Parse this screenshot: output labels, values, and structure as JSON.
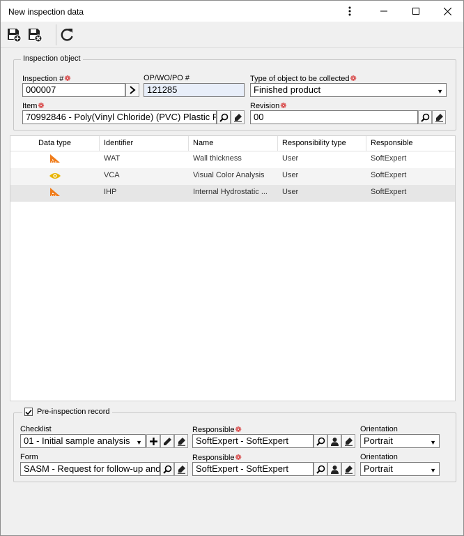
{
  "window": {
    "title": "New inspection data"
  },
  "toolbar": {
    "buttons": [
      {
        "icon": "save-new-icon"
      },
      {
        "icon": "save-close-icon"
      },
      {
        "icon": "refresh-icon"
      }
    ]
  },
  "inspection_object": {
    "legend": "Inspection object",
    "inspection_no": {
      "label": "Inspection #",
      "value": "000007"
    },
    "op_wo_po": {
      "label": "OP/WO/PO #",
      "value": "121285"
    },
    "object_type": {
      "label": "Type of object to be collected",
      "value": "Finished product"
    },
    "item": {
      "label": "Item",
      "value": "70992846 - Poly(Vinyl Chloride) (PVC) Plastic P"
    },
    "revision": {
      "label": "Revision",
      "value": "00"
    }
  },
  "table": {
    "columns": [
      "Data type",
      "Identifier",
      "Name",
      "Responsibility type",
      "Responsible"
    ],
    "rows": [
      {
        "type_icon": "ruler-icon",
        "identifier": "WAT",
        "name": "Wall thickness",
        "resp_type": "User",
        "responsible": "SoftExpert"
      },
      {
        "type_icon": "eye-icon",
        "identifier": "VCA",
        "name": "Visual Color Analysis",
        "resp_type": "User",
        "responsible": "SoftExpert"
      },
      {
        "type_icon": "ruler-icon",
        "identifier": "IHP",
        "name": "Internal Hydrostatic ...",
        "resp_type": "User",
        "responsible": "SoftExpert"
      }
    ]
  },
  "pre_inspection": {
    "legend": "Pre-inspection record",
    "checked": true,
    "checklist": {
      "label": "Checklist",
      "value": "01 - Initial sample analysis"
    },
    "form": {
      "label": "Form",
      "value": "SASM - Request for follow-up and"
    },
    "responsible1": {
      "label": "Responsible",
      "value": "SoftExpert - SoftExpert"
    },
    "responsible2": {
      "label": "Responsible",
      "value": "SoftExpert - SoftExpert"
    },
    "orientation1": {
      "label": "Orientation",
      "value": "Portrait"
    },
    "orientation2": {
      "label": "Orientation",
      "value": "Portrait"
    }
  },
  "colors": {
    "icon_orange": "#f07c1a",
    "eye_yellow": "#e8b400",
    "required_red": "#d21e1e",
    "selected_row": "#e6e6e6",
    "readonly_field": "#e8eef9"
  }
}
